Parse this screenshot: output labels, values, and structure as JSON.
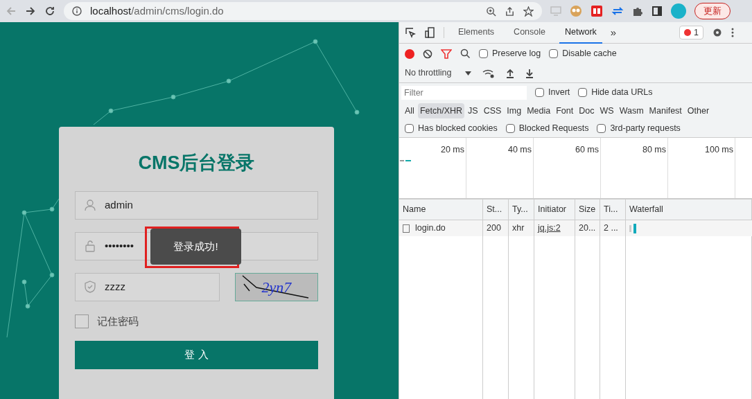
{
  "browser": {
    "url_host": "localhost",
    "url_path": "/admin/cms/login.do",
    "update_button": "更新"
  },
  "login": {
    "title": "CMS后台登录",
    "username": {
      "value": "admin"
    },
    "password": {
      "value": "••••••••"
    },
    "captcha": {
      "value": "zzzz",
      "image_text": "2yn7"
    },
    "remember": {
      "label": "记住密码",
      "checked": false
    },
    "submit": "登 入",
    "toast": {
      "text": "登录成功!",
      "highlighted": true
    }
  },
  "devtools": {
    "tabs": [
      {
        "label": "Elements",
        "selected": false
      },
      {
        "label": "Console",
        "selected": false
      },
      {
        "label": "Network",
        "selected": true
      }
    ],
    "more": "»",
    "error_count": "1",
    "toolbar": {
      "recording": true,
      "preserve_log": {
        "label": "Preserve log",
        "checked": false
      },
      "disable_cache": {
        "label": "Disable cache",
        "checked": false
      },
      "throttling": "No throttling"
    },
    "filter": {
      "placeholder": "Filter",
      "invert": {
        "label": "Invert",
        "checked": false
      },
      "hide_data_urls": {
        "label": "Hide data URLs",
        "checked": false
      }
    },
    "types": [
      {
        "label": "All",
        "selected": false
      },
      {
        "label": "Fetch/XHR",
        "selected": true
      },
      {
        "label": "JS",
        "selected": false
      },
      {
        "label": "CSS",
        "selected": false
      },
      {
        "label": "Img",
        "selected": false
      },
      {
        "label": "Media",
        "selected": false
      },
      {
        "label": "Font",
        "selected": false
      },
      {
        "label": "Doc",
        "selected": false
      },
      {
        "label": "WS",
        "selected": false
      },
      {
        "label": "Wasm",
        "selected": false
      },
      {
        "label": "Manifest",
        "selected": false
      },
      {
        "label": "Other",
        "selected": false
      }
    ],
    "options": [
      {
        "label": "Has blocked cookies",
        "checked": false
      },
      {
        "label": "Blocked Requests",
        "checked": false
      },
      {
        "label": "3rd-party requests",
        "checked": false
      }
    ],
    "timeline": [
      "20 ms",
      "40 ms",
      "60 ms",
      "80 ms",
      "100 ms"
    ],
    "table": {
      "columns": [
        "Name",
        "St...",
        "Ty...",
        "Initiator",
        "Size",
        "Ti...",
        "Waterfall"
      ],
      "rows": [
        {
          "cells": [
            "login.do",
            "200",
            "xhr",
            "jq.js:2",
            "20...",
            "2 ..."
          ]
        }
      ]
    }
  }
}
